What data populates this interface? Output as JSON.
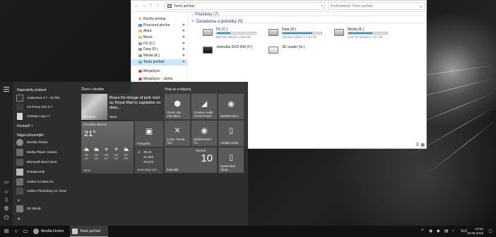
{
  "explorer": {
    "address": "Tento počítač",
    "search_placeholder": "Prehľadávať: Tento počítač",
    "nav_items": [
      {
        "label": "Rýchly prístup",
        "pinned": false
      },
      {
        "label": "Pracovná plocha",
        "pinned": true
      },
      {
        "label": "Akira",
        "pinned": true
      },
      {
        "label": "Music",
        "pinned": true
      },
      {
        "label": "FS (C:)",
        "pinned": true
      },
      {
        "label": "Data (D:)",
        "pinned": true
      },
      {
        "label": "Media (E:)",
        "pinned": true
      },
      {
        "label": "Tento počítač",
        "pinned": true
      },
      {
        "label": "MegaSync",
        "pinned": false
      },
      {
        "label": "MegaSync - Janka",
        "pinned": false
      }
    ],
    "folders_group": "Priečinky (7)",
    "devices_group": "Zariadenia a jednotky (5)",
    "drives": [
      {
        "name": "FS (C:)",
        "size": "550 GB voľných z 464 GB",
        "used_fraction": 0.35
      },
      {
        "name": "Data (D:)",
        "size": "433 GB voľných z 1,81 TB",
        "used_fraction": 0.77
      },
      {
        "name": "Media (E:)",
        "size": "2,80 TB voľných z 7,27 TB",
        "used_fraction": 0.62
      },
      {
        "name": "Jednotka DVD-RW (F:)",
        "size": "",
        "used_fraction": null
      },
      {
        "name": "3D reader (G:)",
        "size": "",
        "used_fraction": null
      }
    ]
  },
  "start": {
    "recent_header": "Naposledy pridané",
    "recent_apps": [
      "Audacious 2.7 - 64 bits",
      "VS Proxy GUI 2.7",
      "Change Log 2.7"
    ],
    "expand_label": "Rozbaliť",
    "most_used_header": "Najpoužívanejšie",
    "most_used_apps": [
      "Mozilla Firefox",
      "Media Player Classic",
      "Microsoft Word 2010",
      "Prieskumník",
      "Adobe Acrobat DC",
      "Adobe Photoshop CC 2018"
    ],
    "letter_hash": "#",
    "hash_apps": [
      "3D Skicár"
    ],
    "letter_a": "A",
    "group1_title": "Život v skratke",
    "group2_title": "Hraj sa a objavuj",
    "news_headline": "Brace for deluge of junk mail as Royal Mail to capitalise on data...",
    "news_source": "Microsoft",
    "news_label": "News",
    "weather": {
      "title": "Prevažne slnečno",
      "temp": "21°",
      "city": "Brno",
      "days": [
        {
          "icon": "cloud-sun",
          "hi": "22°",
          "lo": "12°"
        },
        {
          "icon": "cloud-sun",
          "hi": "24°",
          "lo": "14°"
        },
        {
          "icon": "sun",
          "hi": "25°",
          "lo": "13°"
        },
        {
          "icon": "sun",
          "hi": "24°",
          "lo": "14°"
        },
        {
          "icon": "cloud-sun",
          "hi": "22°",
          "lo": "16°"
        }
      ]
    },
    "photos_label": "Fotografie",
    "stocks": {
      "rows": [
        "26,24",
        "21,552",
        "23,575"
      ],
      "date": "10.05.2018 13:5..."
    },
    "calendar": {
      "day_name": "štvrtok",
      "day_num": "10",
      "label": "Kalendár"
    },
    "tiles": {
      "virtualbox": "Oracle VM VirtualBox",
      "creative": "Creative Audio Control Panel",
      "mediaportal": "MediaPortal 2",
      "codec": "Codec Tweak Tool",
      "mediaportal_tv": "MediaPortal 2 TV...",
      "vivaldi": "Vivaldi Cache",
      "opera": "Opera Mail Temp..."
    }
  },
  "taskbar": {
    "apps": [
      {
        "label": "Mozilla Firefox",
        "active": false
      },
      {
        "label": "Tento počítač",
        "active": true
      }
    ],
    "language": "SLK",
    "time": "13:54",
    "date": "10.05.2018"
  },
  "colors": {
    "drive_bar": "#26a0da",
    "nav_selected": "#cce8ff",
    "tile": "#5a5a5a"
  }
}
